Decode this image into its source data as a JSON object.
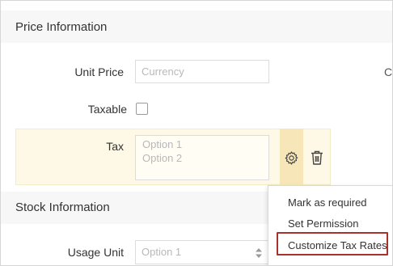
{
  "price_section": {
    "title": "Price Information",
    "unit_price": {
      "label": "Unit Price",
      "placeholder": "Currency"
    },
    "taxable": {
      "label": "Taxable",
      "checked": false
    },
    "tax": {
      "label": "Tax",
      "options": [
        "Option 1",
        "Option 2"
      ]
    },
    "right_truncated_text": "C"
  },
  "stock_section": {
    "title": "Stock Information",
    "usage_unit": {
      "label": "Usage Unit",
      "placeholder": "Option 1"
    }
  },
  "field_menu": {
    "items": [
      "Mark as required",
      "Set Permission",
      "Customize Tax Rates"
    ],
    "highlighted_item": "Customize Tax Rates",
    "highlight_color": "#a8312c"
  },
  "icons": {
    "gear": "gear-icon",
    "trash": "trash-icon",
    "select_arrows": "updown-arrows-icon"
  },
  "colors": {
    "tax_row_bg": "#fdf9e6",
    "gear_cell_bg": "#f7e7b8",
    "header_bg": "#f7f7f7"
  }
}
